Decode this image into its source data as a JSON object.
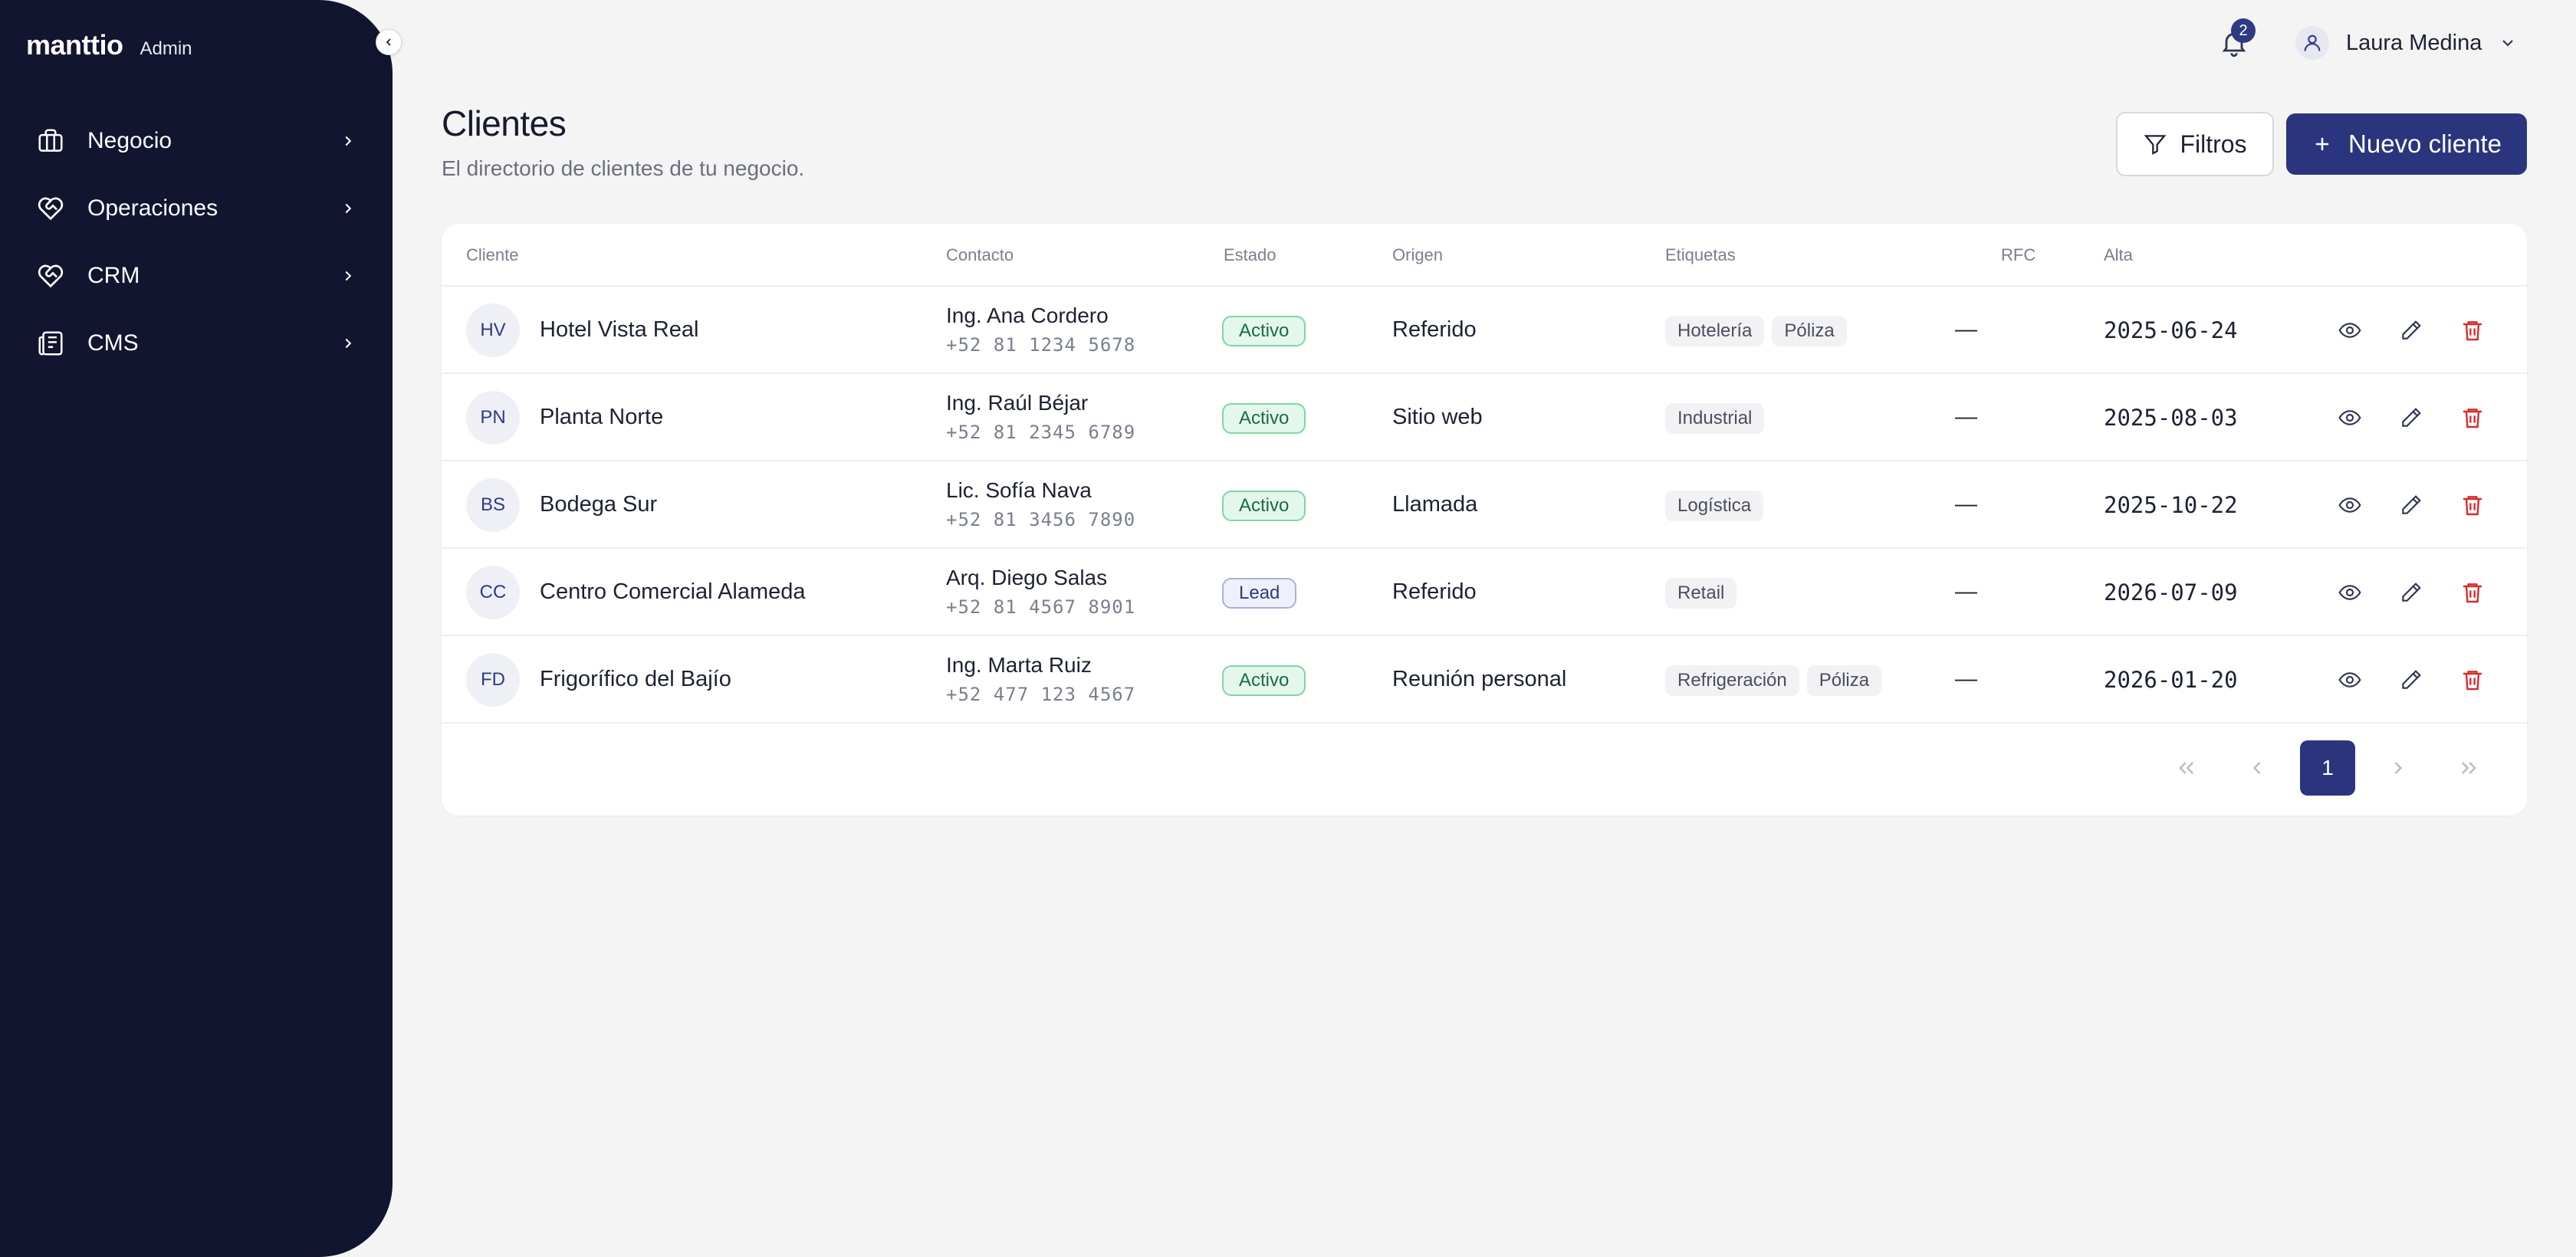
{
  "brand": {
    "logo": "manttio",
    "tag": "Admin"
  },
  "nav": [
    {
      "label": "Negocio",
      "icon": "briefcase-icon"
    },
    {
      "label": "Operaciones",
      "icon": "heart-handshake-icon"
    },
    {
      "label": "CRM",
      "icon": "heart-handshake-icon"
    },
    {
      "label": "CMS",
      "icon": "newspaper-icon"
    }
  ],
  "topbar": {
    "notifications_count": "2",
    "user_name": "Laura Medina"
  },
  "page": {
    "title": "Clientes",
    "subtitle": "El directorio de clientes de tu negocio.",
    "filters_label": "Filtros",
    "new_label": "Nuevo cliente"
  },
  "table": {
    "columns": {
      "cliente": "Cliente",
      "contacto": "Contacto",
      "estado": "Estado",
      "origen": "Origen",
      "etiquetas": "Etiquetas",
      "rfc": "RFC",
      "alta": "Alta"
    },
    "rows": [
      {
        "initials": "HV",
        "name": "Hotel Vista Real",
        "contact": "Ing. Ana Cordero",
        "phone": "+52 81 1234 5678",
        "status": "Activo",
        "origin": "Referido",
        "tags": [
          "Hotelería",
          "Póliza"
        ],
        "rfc": "—",
        "alta": "2025-06-24"
      },
      {
        "initials": "PN",
        "name": "Planta Norte",
        "contact": "Ing. Raúl Béjar",
        "phone": "+52 81 2345 6789",
        "status": "Activo",
        "origin": "Sitio web",
        "tags": [
          "Industrial"
        ],
        "rfc": "—",
        "alta": "2025-08-03"
      },
      {
        "initials": "BS",
        "name": "Bodega Sur",
        "contact": "Lic. Sofía Nava",
        "phone": "+52 81 3456 7890",
        "status": "Activo",
        "origin": "Llamada",
        "tags": [
          "Logística"
        ],
        "rfc": "—",
        "alta": "2025-10-22"
      },
      {
        "initials": "CC",
        "name": "Centro Comercial Alameda",
        "contact": "Arq. Diego Salas",
        "phone": "+52 81 4567 8901",
        "status": "Lead",
        "origin": "Referido",
        "tags": [
          "Retail"
        ],
        "rfc": "—",
        "alta": "2026-07-09"
      },
      {
        "initials": "FD",
        "name": "Frigorífico del Bajío",
        "contact": "Ing. Marta Ruiz",
        "phone": "+52 477 123 4567",
        "status": "Activo",
        "origin": "Reunión personal",
        "tags": [
          "Refrigeración",
          "Póliza"
        ],
        "rfc": "—",
        "alta": "2026-01-20"
      }
    ]
  },
  "pagination": {
    "current_page": "1"
  },
  "colors": {
    "sidebar": "#12152f",
    "primary": "#2b357d",
    "danger": "#d32f2f",
    "active_bg": "#e3f7ec"
  }
}
